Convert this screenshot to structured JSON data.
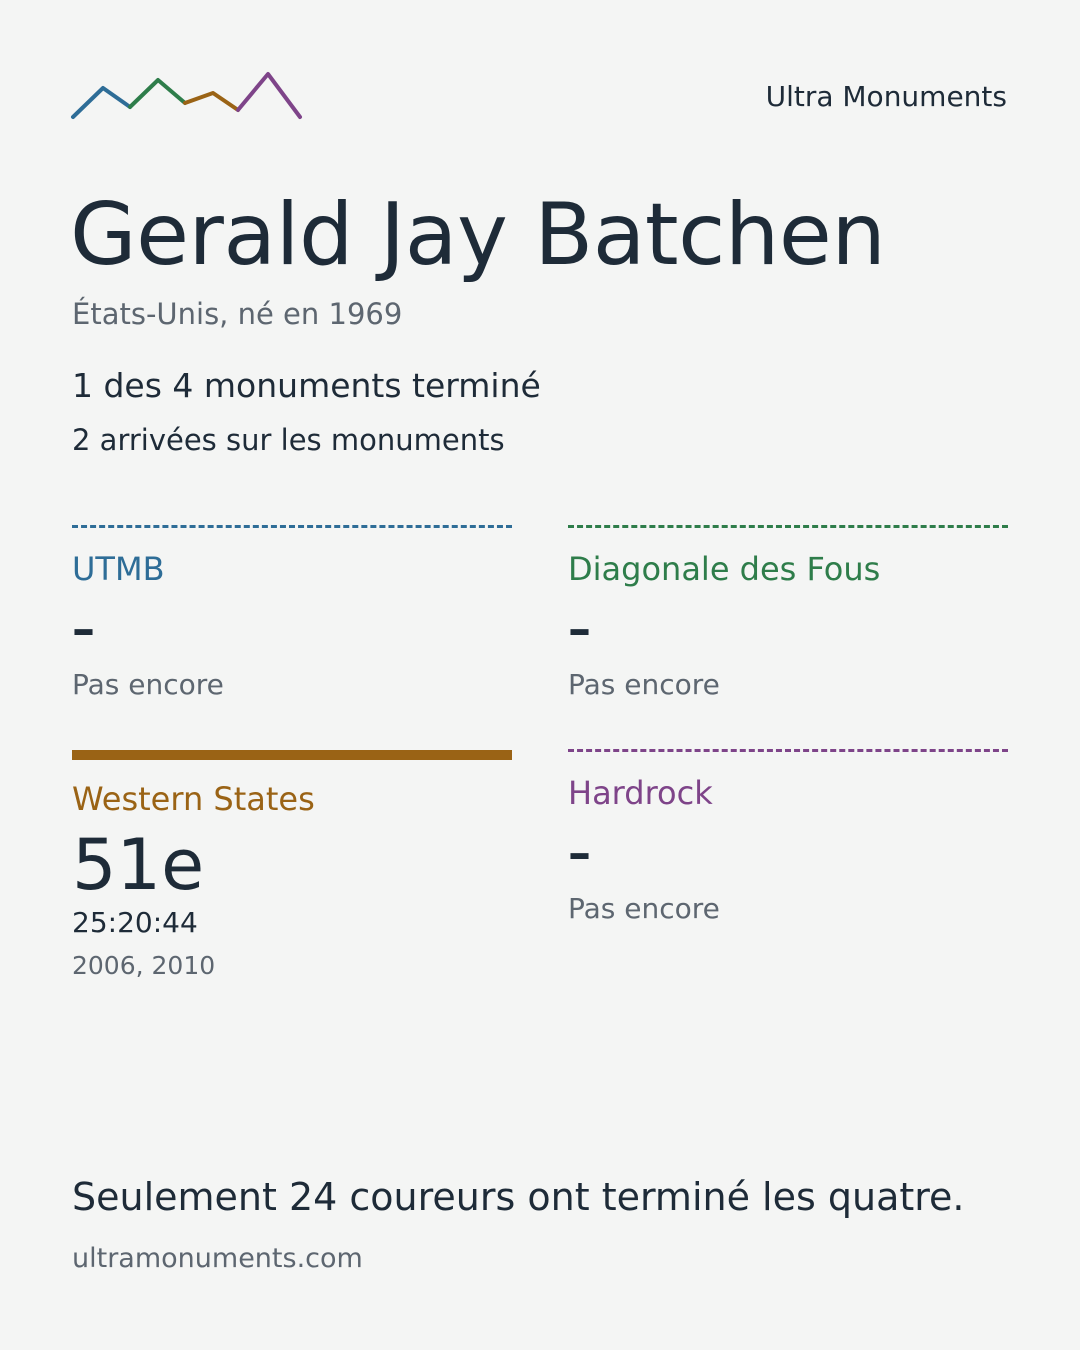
{
  "header": {
    "brand": "Ultra Monuments",
    "logo_icon": "mountain-range-logo-icon",
    "logo_colors": [
      "#2e6d97",
      "#2e7d4a",
      "#9a6315",
      "#7e4489"
    ]
  },
  "runner": {
    "name": "Gerald Jay Batchen",
    "subtitle": "États-Unis, né en 1969",
    "summary": "1 des 4 monuments terminé",
    "arrivals": "2 arrivées sur les monuments"
  },
  "monuments": {
    "utmb": {
      "name": "UTMB",
      "color": "#2e6d97",
      "dash": "–",
      "status": "Pas encore"
    },
    "diagonale": {
      "name": "Diagonale des Fous",
      "color": "#2e7d4a",
      "dash": "–",
      "status": "Pas encore"
    },
    "western": {
      "name": "Western States",
      "color": "#9a6315",
      "rank": "51e",
      "time": "25:20:44",
      "years": "2006, 2010"
    },
    "hardrock": {
      "name": "Hardrock",
      "color": "#7e4489",
      "dash": "–",
      "status": "Pas encore"
    }
  },
  "footer": {
    "note": "Seulement 24 coureurs ont terminé les quatre.",
    "site": "ultramonuments.com"
  }
}
